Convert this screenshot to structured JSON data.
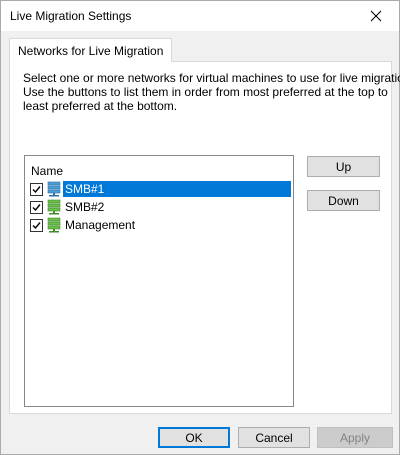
{
  "window": {
    "title": "Live Migration Settings",
    "close_label": "Close"
  },
  "tab": {
    "label": "Networks for Live Migration"
  },
  "description": {
    "line1": "Select one or more networks for virtual machines to use for live migration.",
    "line2": "Use the buttons to list them in order from most preferred at the top to",
    "line3": "least preferred at the bottom."
  },
  "list": {
    "header": "Name",
    "items": [
      {
        "label": "SMB#1",
        "checked": true,
        "selected": true,
        "icon": "network-adapter-icon"
      },
      {
        "label": "SMB#2",
        "checked": true,
        "selected": false,
        "icon": "network-adapter-icon"
      },
      {
        "label": "Management",
        "checked": true,
        "selected": false,
        "icon": "network-adapter-icon"
      }
    ]
  },
  "side_buttons": {
    "up": "Up",
    "down": "Down"
  },
  "footer": {
    "ok": "OK",
    "cancel": "Cancel",
    "apply": "Apply",
    "apply_enabled": false
  },
  "colors": {
    "selection": "#0078d7",
    "dialog_bg": "#f0f0f0",
    "button_bg": "#e1e1e1",
    "disabled_text": "#838383"
  }
}
